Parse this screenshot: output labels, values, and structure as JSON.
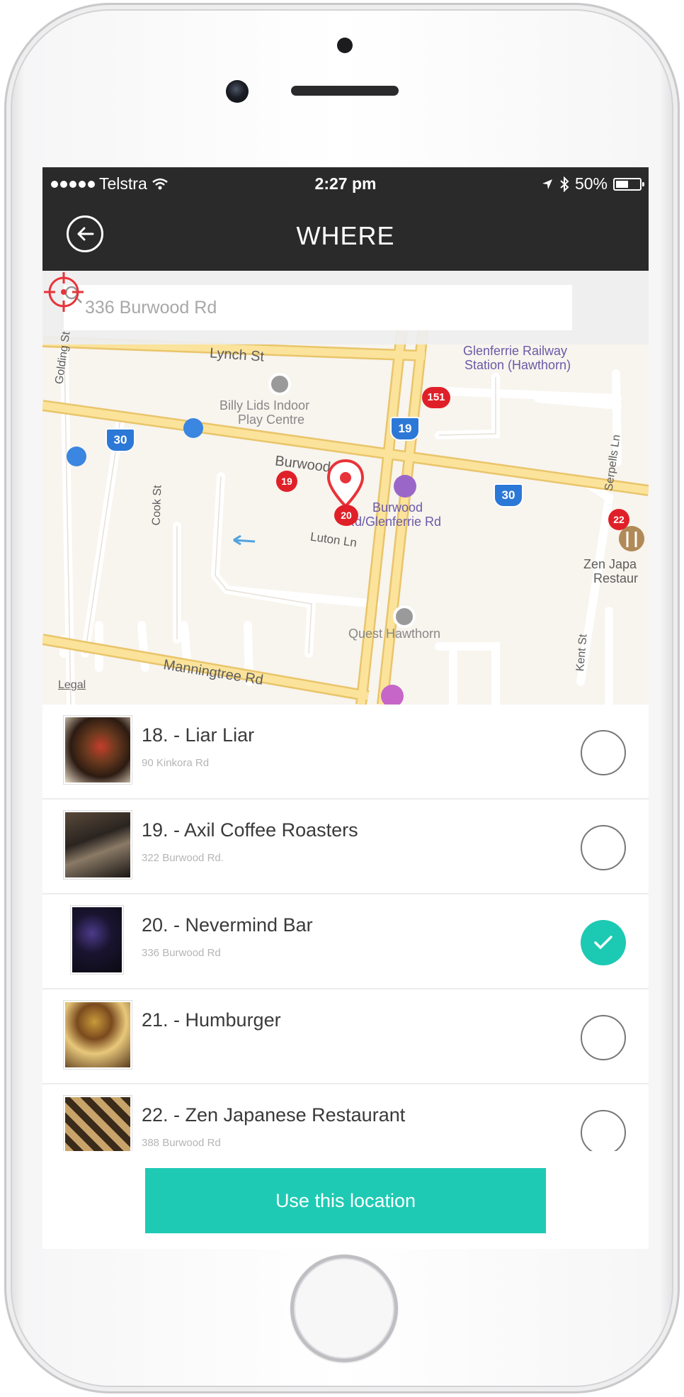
{
  "status_bar": {
    "carrier": "Telstra",
    "time": "2:27 pm",
    "battery": "50%"
  },
  "header": {
    "title": "WHERE"
  },
  "search": {
    "placeholder": "336 Burwood Rd"
  },
  "map": {
    "labels": {
      "lynch": "Lynch St",
      "glenferrie_station_1": "Glenferrie Railway",
      "glenferrie_station_2": "Station (Hawthorn)",
      "billy_1": "Billy Lids Indoor",
      "billy_2": "Play Centre",
      "burwood_rd": "Burwood Rd",
      "stop_1": "Burwood",
      "stop_2": "Rd/Glenferrie Rd",
      "cook": "Cook St",
      "luton": "Luton Ln",
      "zen_1": "Zen Japa",
      "zen_2": "Restaur",
      "quest": "Quest Hawthorn",
      "manningtree": "Manningtree Rd",
      "golding": "Golding St",
      "kent": "Kent St",
      "serpells": "Serpells Ln"
    },
    "badges": {
      "b151": "151",
      "b19_stop": "19",
      "b19_route": "19",
      "b30_left": "30",
      "b30_right": "30",
      "b20": "20",
      "b22": "22"
    },
    "legal": "Legal"
  },
  "places": [
    {
      "title": "18. - Liar Liar",
      "address": "90 Kinkora Rd",
      "selected": false
    },
    {
      "title": "19. - Axil Coffee Roasters",
      "address": "322 Burwood Rd.",
      "selected": false
    },
    {
      "title": "20. - Nevermind Bar",
      "address": "336 Burwood Rd",
      "selected": true
    },
    {
      "title": "21. - Humburger",
      "address": "",
      "selected": false
    },
    {
      "title": "22. - Zen Japanese Restaurant",
      "address": "388 Burwood Rd",
      "selected": false
    }
  ],
  "action": {
    "use_location": "Use this location"
  },
  "colors": {
    "accent": "#1fcab4",
    "header_bg": "#2a2a2a",
    "pin_red": "#e8333a"
  }
}
